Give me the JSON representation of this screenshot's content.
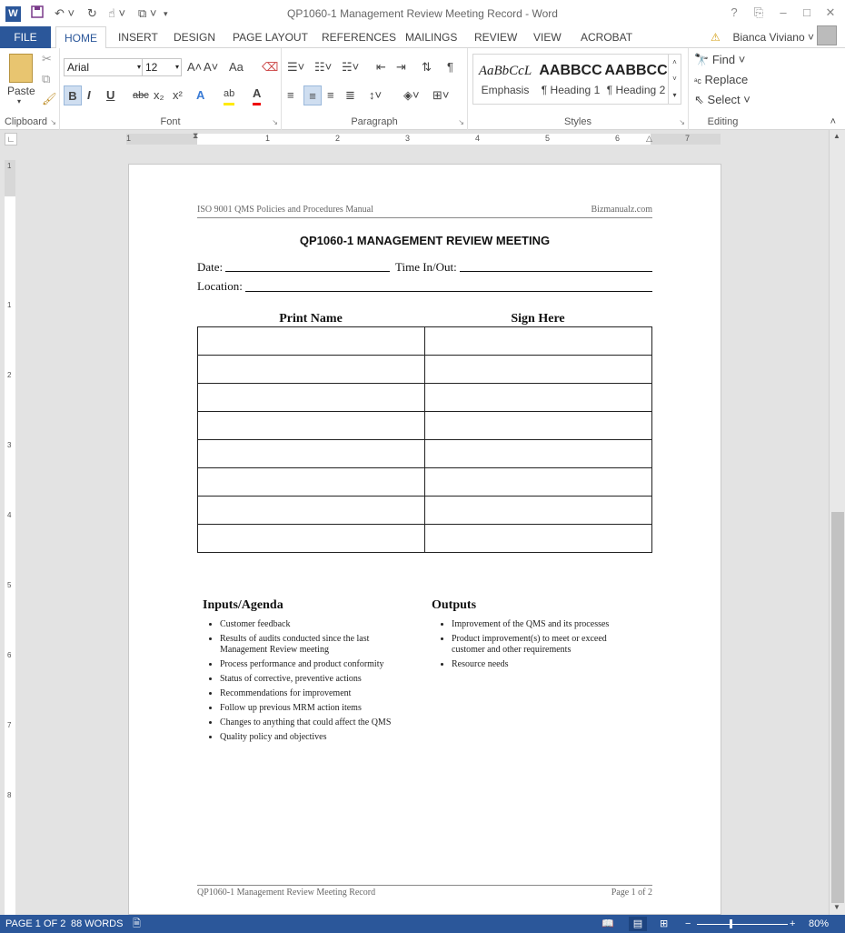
{
  "titlebar": {
    "title": "QP1060-1 Management Review Meeting Record - Word",
    "app_icon": "W",
    "help": "?",
    "restore_ribbon": "⎘",
    "minimize": "–",
    "maximize": "□",
    "close": "✕"
  },
  "tabs": {
    "file": "FILE",
    "home": "HOME",
    "insert": "INSERT",
    "design": "DESIGN",
    "page_layout": "PAGE LAYOUT",
    "references": "REFERENCES",
    "mailings": "MAILINGS",
    "review": "REVIEW",
    "view": "VIEW",
    "acrobat": "ACROBAT"
  },
  "user": {
    "name": "Bianca Viviano",
    "warning": "⚠"
  },
  "ribbon": {
    "clipboard": {
      "label": "Clipboard",
      "paste": "Paste"
    },
    "font": {
      "label": "Font",
      "family": "Arial",
      "size": "12",
      "grow": "A˄",
      "shrink": "A˅",
      "case": "Aa",
      "bold": "B",
      "italic": "I",
      "underline": "U",
      "strike": "abc",
      "sub": "x₂",
      "sup": "x²",
      "effects": "A",
      "highlight": "ab",
      "color": "A"
    },
    "paragraph": {
      "label": "Paragraph",
      "pilcrow": "¶",
      "sort": "⇅"
    },
    "styles": {
      "label": "Styles",
      "items": [
        {
          "preview": "AaBbCcL",
          "name": "Emphasis"
        },
        {
          "preview": "AABBCC",
          "name": "¶ Heading 1"
        },
        {
          "preview": "AABBCC",
          "name": "¶ Heading 2"
        }
      ]
    },
    "editing": {
      "label": "Editing",
      "find": "Find",
      "replace": "Replace",
      "select": "Select"
    }
  },
  "ruler": {
    "marks": [
      "1",
      "1",
      "2",
      "3",
      "4",
      "5",
      "6",
      "7"
    ],
    "vmarks": [
      "1",
      "1",
      "2",
      "3",
      "4",
      "5",
      "6",
      "7",
      "8"
    ]
  },
  "document": {
    "header_left": "ISO 9001 QMS Policies and Procedures Manual",
    "header_right": "Bizmanualz.com",
    "title": "QP1060-1 MANAGEMENT REVIEW MEETING",
    "date_label": "Date:",
    "time_label": "Time In/Out:",
    "location_label": "Location:",
    "col1": "Print Name",
    "col2": "Sign Here",
    "inputs_heading": "Inputs/Agenda",
    "inputs": [
      "Customer feedback",
      "Results of audits conducted since the last Management Review meeting",
      "Process performance and product conformity",
      "Status of corrective, preventive actions",
      "Recommendations for improvement",
      "Follow up previous MRM action items",
      "Changes to anything that could affect the QMS",
      "Quality policy and objectives"
    ],
    "outputs_heading": "Outputs",
    "outputs": [
      "Improvement of the QMS and its processes",
      "Product improvement(s) to meet or exceed customer and other requirements",
      "Resource needs"
    ],
    "footer_left": "QP1060-1 Management Review Meeting Record",
    "footer_right": "Page 1 of 2"
  },
  "status": {
    "page": "PAGE 1 OF 2",
    "words": "88 WORDS",
    "zoom": "80%",
    "zoom_minus": "−",
    "zoom_plus": "+"
  },
  "colors": {
    "accent": "#2b579a"
  }
}
